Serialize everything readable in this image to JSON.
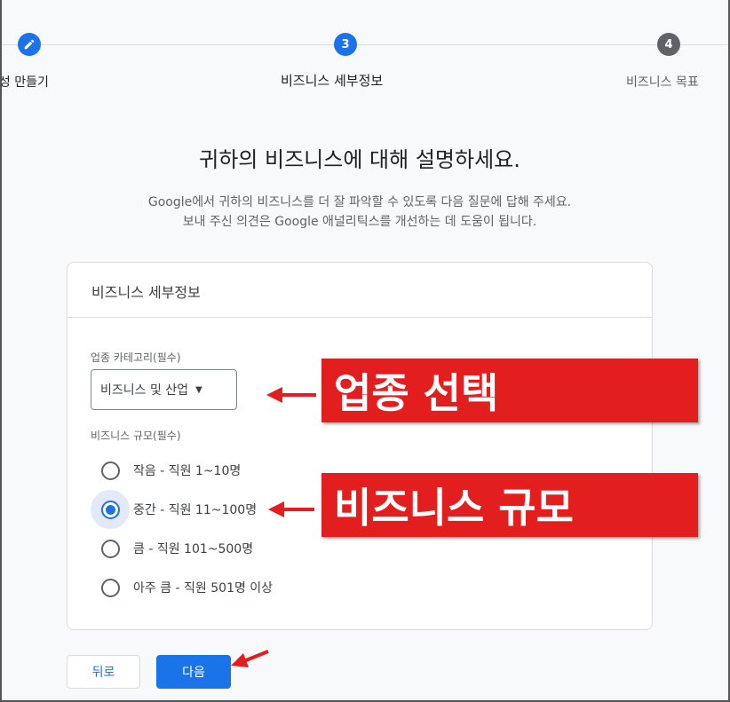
{
  "stepper": {
    "steps": [
      {
        "label": "속성 만들기",
        "state": "done"
      },
      {
        "label": "비즈니스 세부정보",
        "number": "3",
        "state": "active"
      },
      {
        "label": "비즈니스 목표",
        "number": "4",
        "state": "todo"
      }
    ]
  },
  "heading": {
    "title": "귀하의 비즈니스에 대해 설명하세요.",
    "subtitle_line1": "Google에서 귀하의 비즈니스를 더 잘 파악할 수 있도록 다음 질문에 답해 주세요.",
    "subtitle_line2": "보내 주신 의견은 Google 애널리틱스를 개선하는 데 도움이 됩니다."
  },
  "card": {
    "header": "비즈니스 세부정보",
    "category": {
      "label": "업종 카테고리(필수)",
      "selected_value": "비즈니스 및 산업"
    },
    "size": {
      "label": "비즈니스 규모(필수)",
      "options": [
        {
          "label": "작음 - 직원 1~10명",
          "checked": false
        },
        {
          "label": "중간 - 직원 11~100명",
          "checked": true
        },
        {
          "label": "큼 - 직원 101~500명",
          "checked": false
        },
        {
          "label": "아주 큼 - 직원 501명 이상",
          "checked": false
        }
      ]
    }
  },
  "buttons": {
    "back_label": "뒤로",
    "next_label": "다음"
  },
  "annotations": {
    "category_banner": "업종 선택",
    "size_banner": "비즈니스 규모"
  },
  "colors": {
    "accent": "#1a73e8",
    "annotation_red": "#e31e1e"
  }
}
